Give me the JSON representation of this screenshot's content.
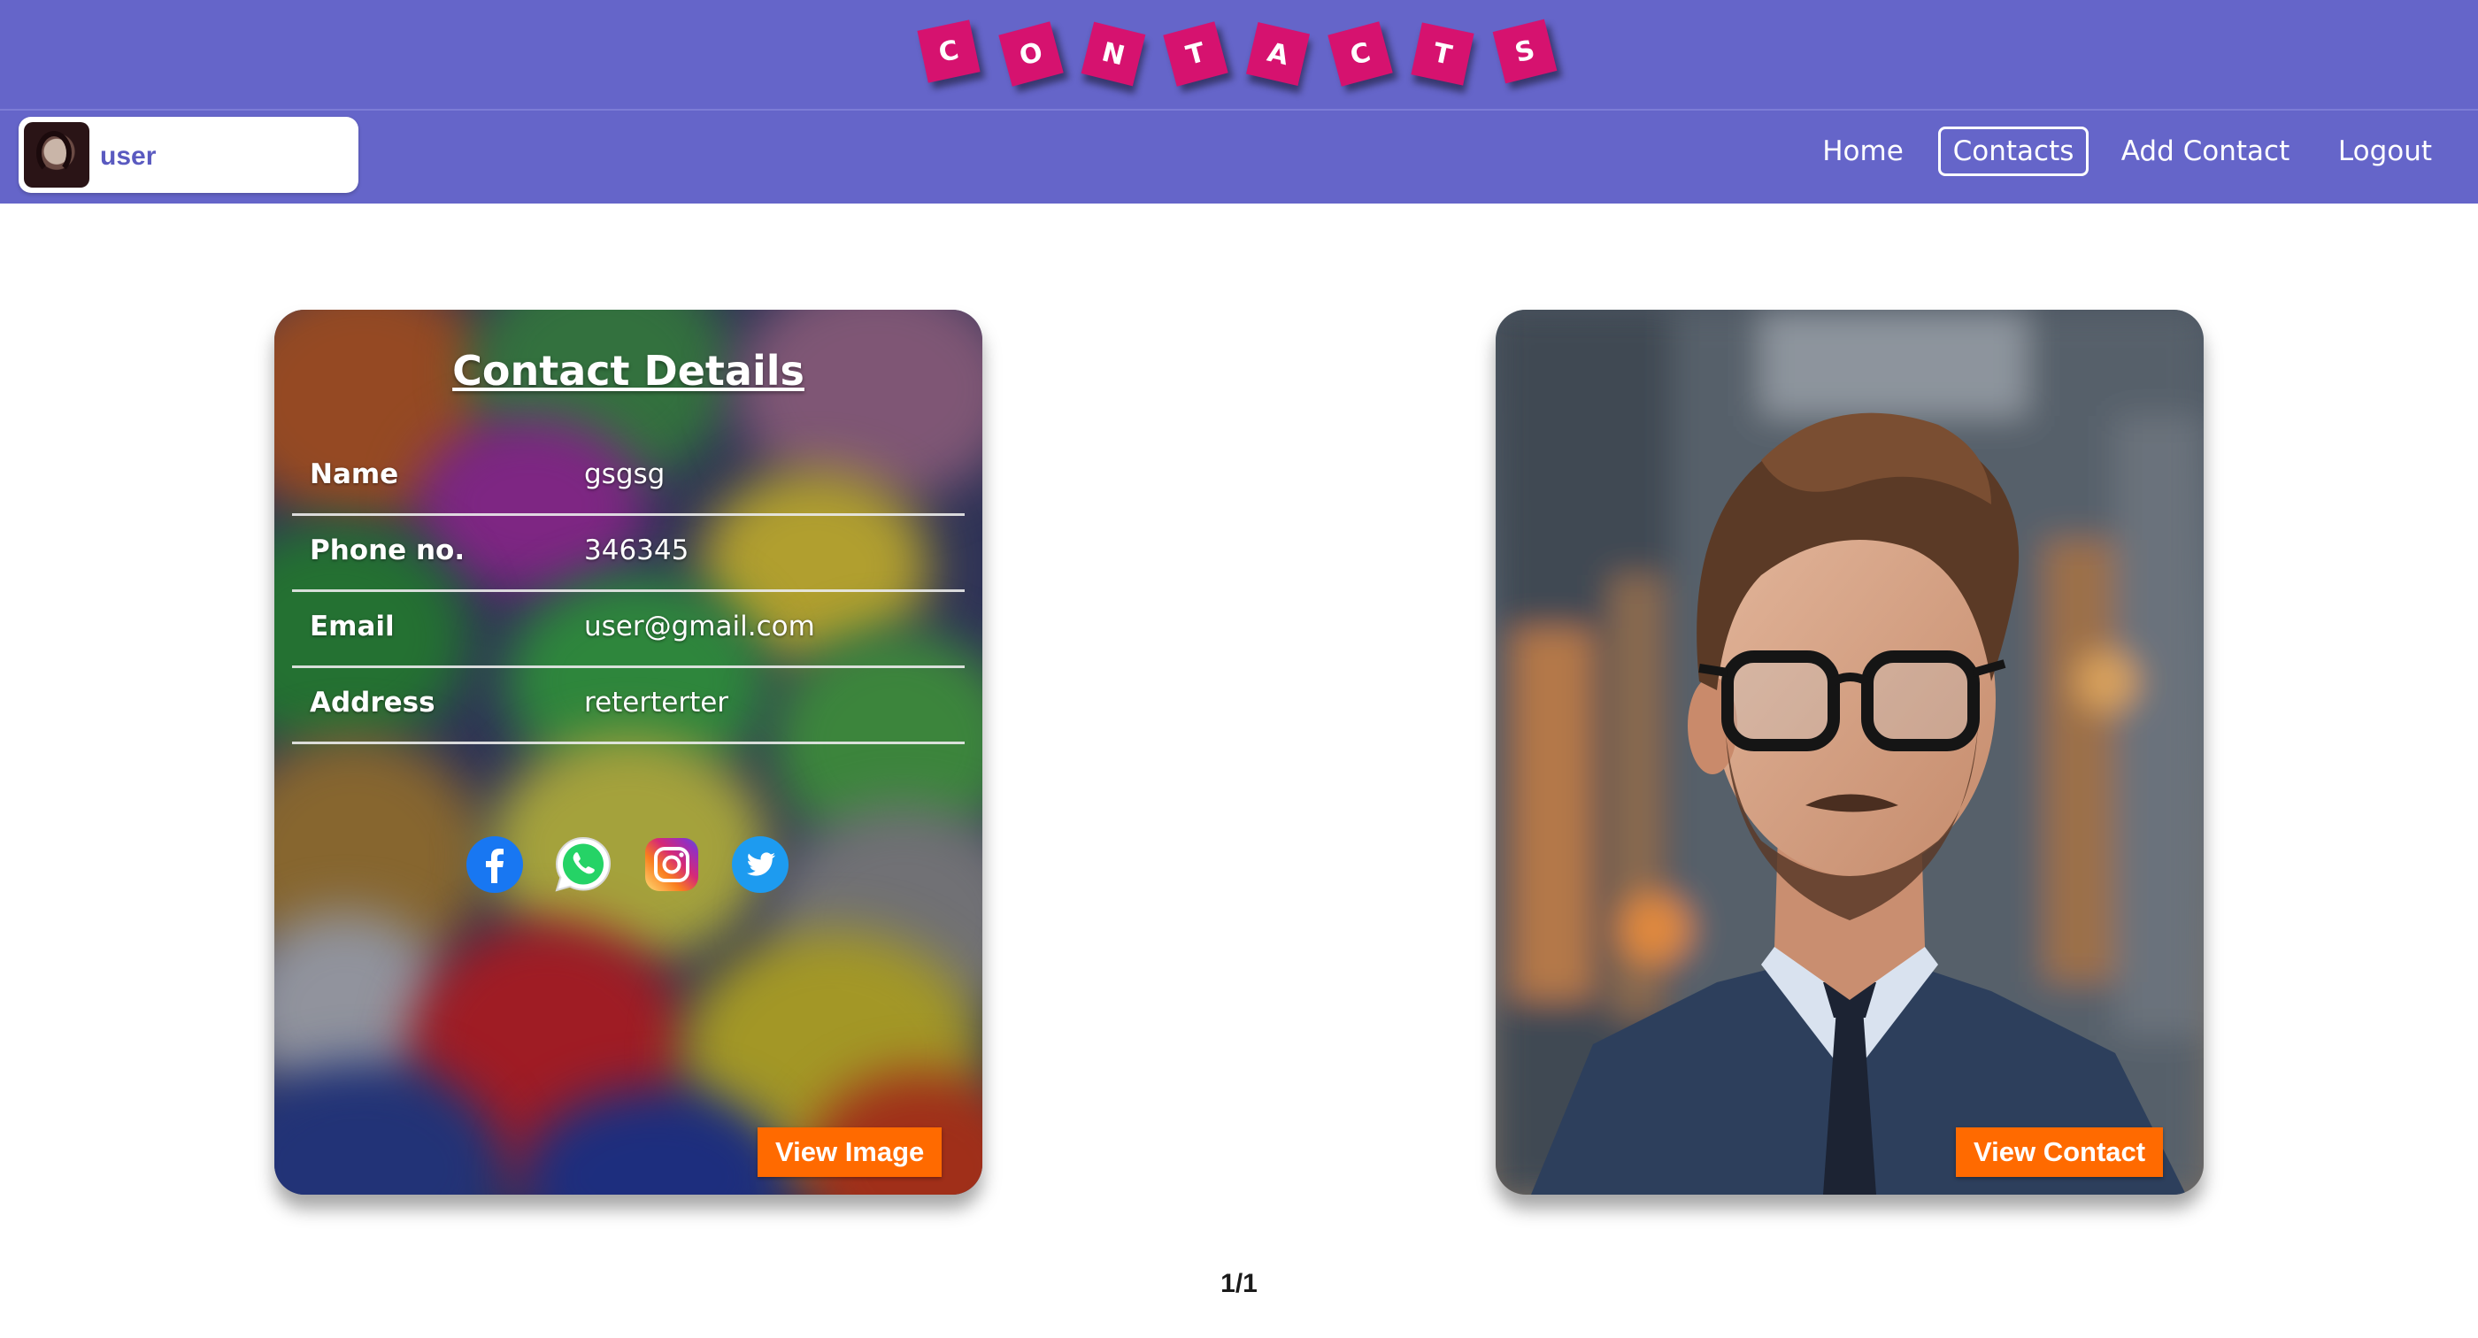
{
  "header": {
    "title_letters": [
      "C",
      "O",
      "N",
      "T",
      "A",
      "C",
      "T",
      "S"
    ],
    "colors": {
      "bar": "#6565c9",
      "tile": "#d6126f"
    }
  },
  "user": {
    "name": "user"
  },
  "nav": {
    "items": [
      {
        "label": "Home"
      },
      {
        "label": "Contacts",
        "active": true
      },
      {
        "label": "Add Contact"
      },
      {
        "label": "Logout"
      }
    ]
  },
  "details": {
    "title": "Contact Details",
    "rows": [
      {
        "label": "Name",
        "value": "gsgsg"
      },
      {
        "label": "Phone no.",
        "value": "346345"
      },
      {
        "label": "Email",
        "value": "user@gmail.com"
      },
      {
        "label": "Address",
        "value": "reterterter"
      }
    ],
    "social_icons": [
      "facebook-icon",
      "whatsapp-icon",
      "instagram-icon",
      "twitter-icon"
    ],
    "view_image_label": "View Image"
  },
  "image_card": {
    "view_contact_label": "View Contact"
  },
  "pagination": {
    "text": "1/1"
  },
  "colors": {
    "button": "#ff6a00"
  }
}
